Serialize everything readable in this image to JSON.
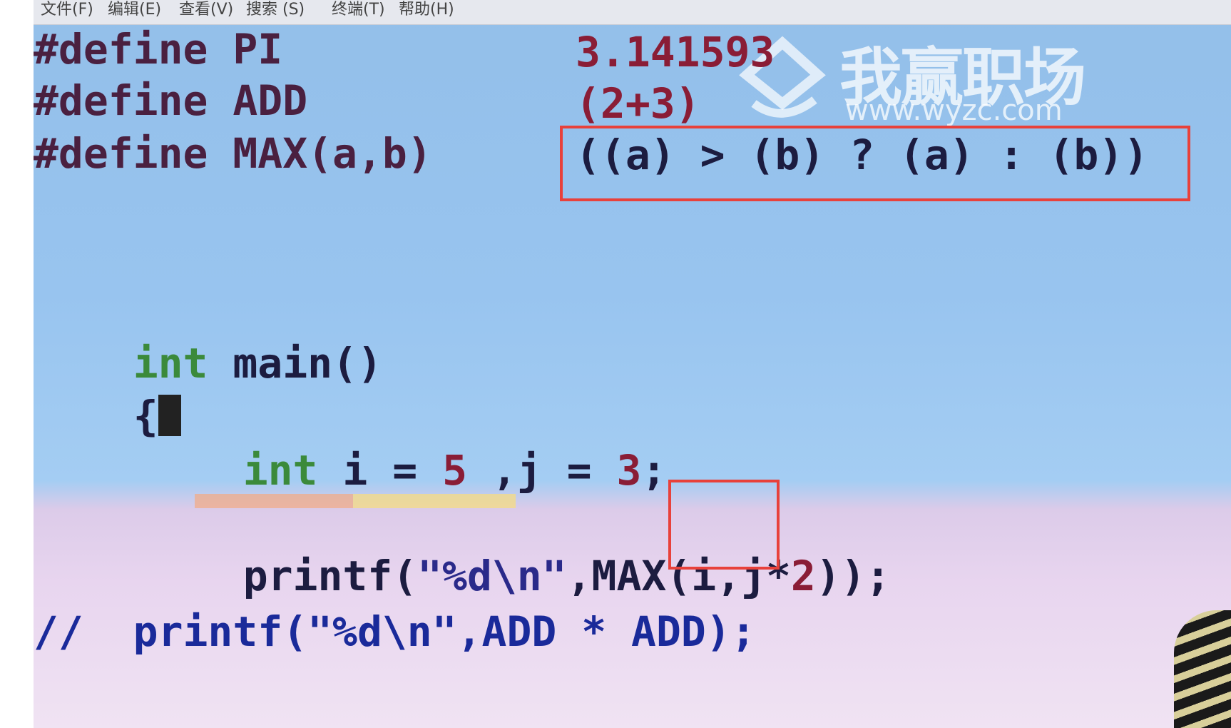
{
  "menubar": {
    "items": [
      "文件(F)",
      "编辑(E)",
      "查看(V)",
      "搜索 (S)",
      "终端(T)",
      "帮助(H)"
    ]
  },
  "code": {
    "line1": {
      "directive": "#define PI",
      "value": "3.141593"
    },
    "line2": {
      "directive": "#define ADD",
      "value": "(2+3)"
    },
    "line3": {
      "directive": "#define MAX(a,b)",
      "value": "((a) > (b) ? (a) : (b))"
    },
    "main_kw": "int",
    "main_rest": " main()",
    "brace": "{",
    "decl": {
      "kw": "int",
      "name_i": " i = ",
      "val_i": "5",
      "name_j": " ,j = ",
      "val_j": "3",
      "end": ";"
    },
    "printf_max": {
      "pre": "printf(",
      "fmt": "\"%d\\n\"",
      "macro": ",MAX(i,",
      "arg_j": "j*",
      "arg_num": "2",
      "close": "));"
    },
    "comment_line": "//  printf(\"%d\\n\",ADD * ADD);"
  },
  "watermark": {
    "brand": "我赢职场",
    "url": "www.wyzc.com"
  },
  "colors": {
    "annotation_red": "#e8413b",
    "keyword_green": "#3b8a3b",
    "number_red": "#8a1d36"
  }
}
